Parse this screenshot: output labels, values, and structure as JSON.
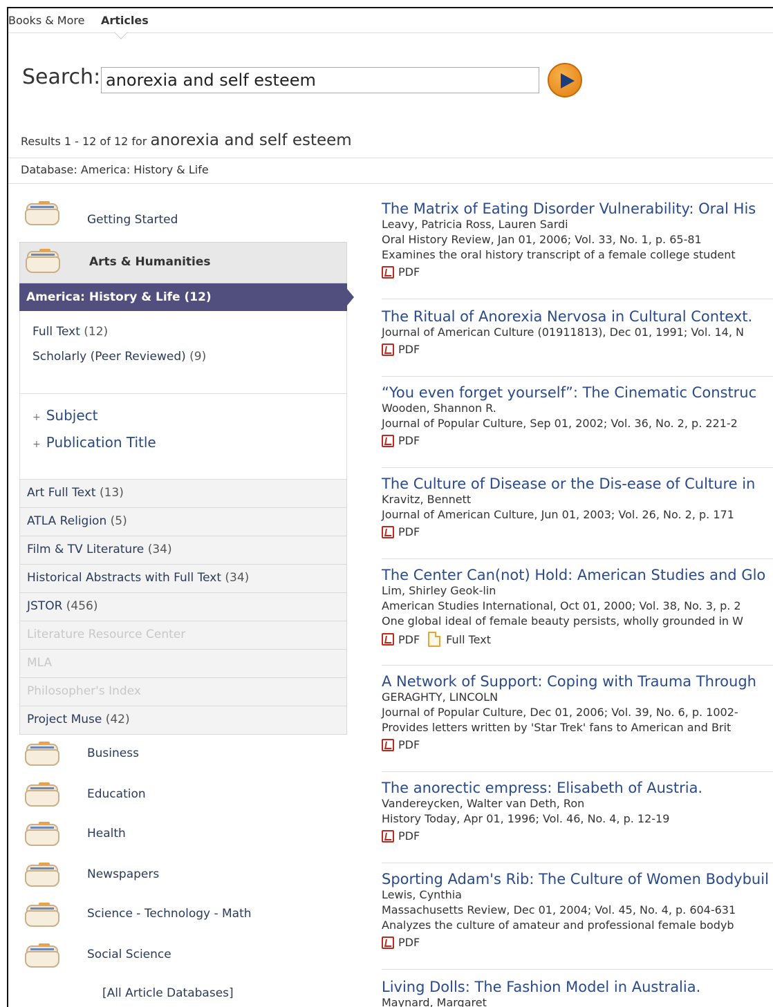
{
  "nav": {
    "books": "Books & More",
    "articles": "Articles"
  },
  "search": {
    "label": "Search:",
    "value": "anorexia and self esteem"
  },
  "summary": {
    "prefix": "Results 1 - 12 of 12 for",
    "query": "anorexia and self esteem"
  },
  "database": "Database: America: History & Life",
  "sidebar": {
    "getting_started": "Getting Started",
    "arts": "Arts & Humanities",
    "active_db": "America: History & Life (12)",
    "filters": [
      {
        "label": "Full Text",
        "count": "(12)"
      },
      {
        "label": "Scholarly (Peer Reviewed)",
        "count": "(9)"
      }
    ],
    "facets": [
      "Subject",
      "Publication Title"
    ],
    "databases": [
      {
        "label": "Art Full Text",
        "count": "(13)"
      },
      {
        "label": "ATLA Religion",
        "count": "(5)"
      },
      {
        "label": "Film & TV Literature",
        "count": "(34)"
      },
      {
        "label": "Historical Abstracts with Full Text",
        "count": "(34)"
      },
      {
        "label": "JSTOR",
        "count": "(456)"
      },
      {
        "label": "Literature Resource Center",
        "count": ""
      },
      {
        "label": "MLA",
        "count": ""
      },
      {
        "label": "Philosopher's Index",
        "count": ""
      },
      {
        "label": "Project Muse",
        "count": "(42)"
      }
    ],
    "categories": [
      "Business",
      "Education",
      "Health",
      "Newspapers",
      "Science - Technology - Math",
      "Social Science"
    ],
    "all_databases": "[All Article Databases]"
  },
  "results": [
    {
      "title": "The Matrix of Eating Disorder Vulnerability: Oral His",
      "author": "Leavy, Patricia Ross, Lauren Sardi",
      "source": "Oral History Review, Jan 01, 2006; Vol. 33, No. 1, p. 65-81",
      "abstract": "Examines the oral history transcript of a female college student",
      "pdf": "PDF"
    },
    {
      "title": "The Ritual of Anorexia Nervosa in Cultural Context.",
      "source": "Journal of American Culture (01911813), Dec 01, 1991; Vol. 14, N",
      "pdf": "PDF"
    },
    {
      "title": "“You even forget yourself”: The Cinematic Construc",
      "author": "Wooden, Shannon R.",
      "source": "Journal of Popular Culture, Sep 01, 2002; Vol. 36, No. 2, p. 221-2",
      "pdf": "PDF"
    },
    {
      "title": "The Culture of Disease or the Dis-ease of Culture in",
      "author": "Kravitz, Bennett",
      "source": "Journal of American Culture, Jun 01, 2003; Vol. 26, No. 2, p. 171",
      "pdf": "PDF"
    },
    {
      "title": "The Center Can(not) Hold: American Studies and Glo",
      "author": "Lim, Shirley Geok-lin",
      "source": "American Studies International, Oct 01, 2000; Vol. 38, No. 3, p. 2",
      "abstract": "One global ideal of female beauty persists, wholly grounded in W",
      "pdf": "PDF",
      "fulltext": "Full Text"
    },
    {
      "title": "A Network of Support: Coping with Trauma Through",
      "author": "GERAGHTY, LINCOLN",
      "source": "Journal of Popular Culture, Dec 01, 2006; Vol. 39, No. 6, p. 1002-",
      "abstract": "Provides letters written by 'Star Trek' fans to American and Brit",
      "pdf": "PDF"
    },
    {
      "title": "The anorectic empress: Elisabeth of Austria.",
      "author": "Vandereycken, Walter van Deth, Ron",
      "source": "History Today, Apr 01, 1996; Vol. 46, No. 4, p. 12-19",
      "pdf": "PDF"
    },
    {
      "title": "Sporting Adam's Rib: The Culture of Women Bodybuil",
      "author": "Lewis, Cynthia",
      "source": "Massachusetts Review, Dec 01, 2004; Vol. 45, No. 4, p. 604-631",
      "abstract": "Analyzes the culture of amateur and professional female bodyb",
      "pdf": "PDF"
    },
    {
      "title": "Living Dolls: The Fashion Model in Australia.",
      "author": "Maynard, Margaret"
    }
  ]
}
